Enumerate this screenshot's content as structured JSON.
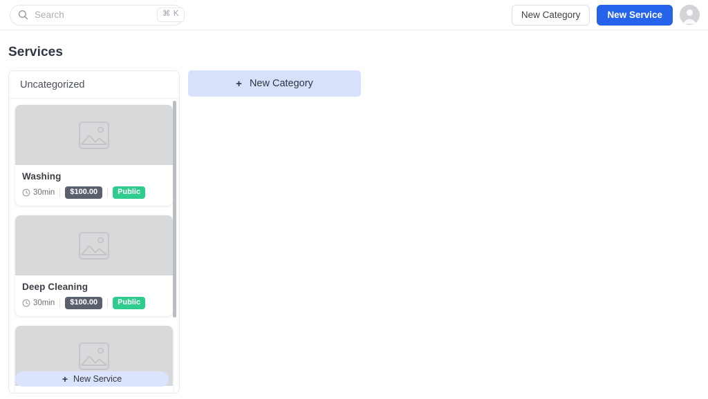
{
  "topbar": {
    "search": {
      "placeholder": "Search",
      "value": "",
      "shortcut": "⌘ K",
      "icon": "search-icon"
    },
    "new_category_label": "New Category",
    "new_service_label": "New Service",
    "avatar_icon": "user-avatar-icon"
  },
  "page": {
    "title": "Services"
  },
  "category": {
    "name": "Uncategorized",
    "new_service_label": "New Service",
    "new_service_plus": "+",
    "services": [
      {
        "name": "Washing",
        "duration": "30min",
        "price": "$100.00",
        "visibility": "Public",
        "image_icon": "image-placeholder-icon"
      },
      {
        "name": "Deep Cleaning",
        "duration": "30min",
        "price": "$100.00",
        "visibility": "Public",
        "image_icon": "image-placeholder-icon"
      },
      {
        "name": "",
        "duration": "",
        "price": "",
        "visibility": "",
        "image_icon": "image-placeholder-icon"
      }
    ]
  },
  "new_category_button": {
    "label": "New Category",
    "plus": "+"
  },
  "colors": {
    "primary": "#2563eb",
    "badge_price": "#5a606e",
    "badge_public": "#2ecc8f",
    "soft_blue": "#d7e1fa",
    "image_placeholder": "#d8d9db"
  }
}
